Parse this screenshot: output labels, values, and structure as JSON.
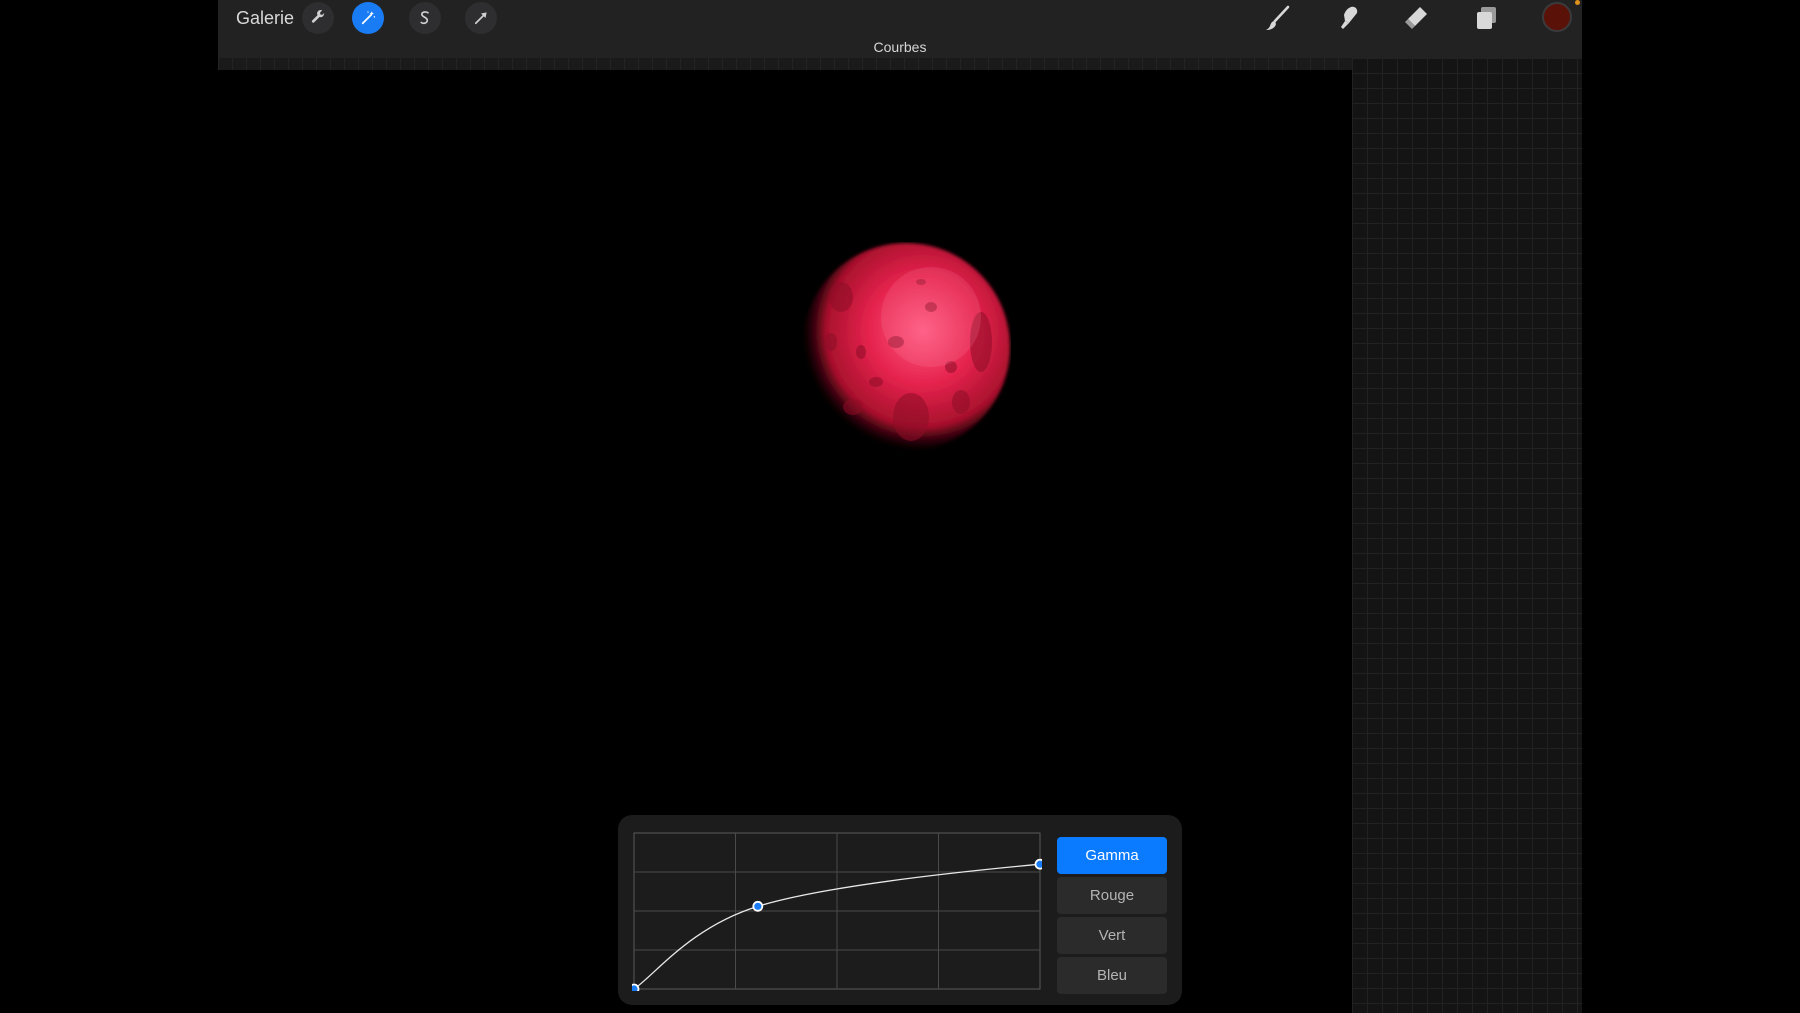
{
  "toolbar": {
    "gallery_label": "Galerie",
    "left_tools": [
      {
        "icon": "wrench-icon",
        "active": false
      },
      {
        "icon": "magic-wand-icon",
        "active": true
      },
      {
        "icon": "selection-icon",
        "active": false
      },
      {
        "icon": "transform-arrow-icon",
        "active": false
      }
    ],
    "right_tools": [
      {
        "icon": "brush-icon"
      },
      {
        "icon": "smudge-icon"
      },
      {
        "icon": "eraser-icon"
      },
      {
        "icon": "layers-icon"
      }
    ],
    "current_color": "#5a1208",
    "accent_color": "#1a7cf5"
  },
  "adjustment": {
    "title": "Courbes"
  },
  "curves": {
    "channels": [
      {
        "label": "Gamma",
        "active": true
      },
      {
        "label": "Rouge",
        "active": false
      },
      {
        "label": "Vert",
        "active": false
      },
      {
        "label": "Bleu",
        "active": false
      }
    ],
    "control_points": [
      {
        "input": 0.0,
        "output": 0.0
      },
      {
        "input": 0.305,
        "output": 0.53
      },
      {
        "input": 1.0,
        "output": 0.8
      }
    ]
  },
  "canvas": {
    "subject": "planet-illustration",
    "planet_color": "#e2224a"
  }
}
